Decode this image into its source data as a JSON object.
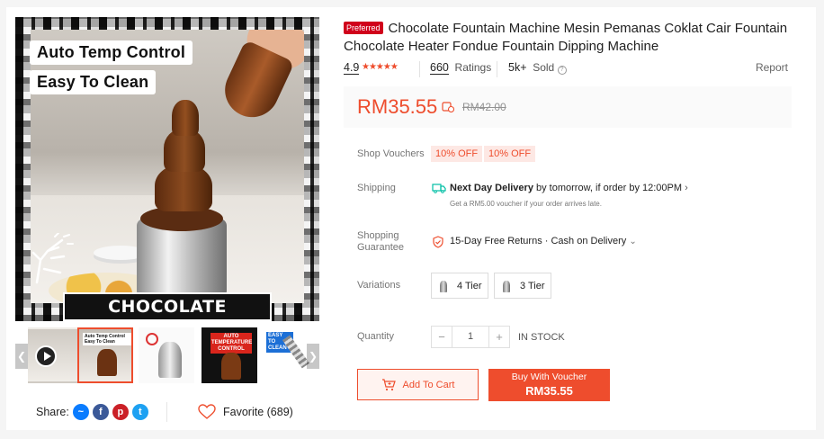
{
  "gallery": {
    "main_image": {
      "tag_top": "Auto Temp Control",
      "tag_bottom": "Easy To Clean",
      "banner": "CHOCOLATE FONDUE",
      "alt": "chocolate fountain photo"
    },
    "thumbnails": [
      {
        "kind": "video",
        "icon": "play-icon"
      },
      {
        "kind": "image",
        "caption": "Auto Temp Control Easy To Clean"
      },
      {
        "kind": "image",
        "caption": ""
      },
      {
        "kind": "image",
        "caption": "AUTO TEMPERATURE CONTROL"
      },
      {
        "kind": "image",
        "caption": "EASY TO CLEAN"
      }
    ]
  },
  "share": {
    "label": "Share:",
    "networks": [
      {
        "name": "messenger",
        "icon": "messenger-icon",
        "color": "#0a7cff",
        "glyph": "~"
      },
      {
        "name": "facebook",
        "icon": "facebook-icon",
        "color": "#3b5998",
        "glyph": "f"
      },
      {
        "name": "pinterest",
        "icon": "pinterest-icon",
        "color": "#cb2027",
        "glyph": "p"
      },
      {
        "name": "twitter",
        "icon": "twitter-icon",
        "color": "#1da1f2",
        "glyph": "t"
      }
    ]
  },
  "favorite": {
    "label": "Favorite (689)"
  },
  "product": {
    "badge": "Preferred",
    "title": "Chocolate Fountain Machine Mesin Pemanas Coklat Cair Fountain Chocolate Heater Fondue Fountain Dipping Machine",
    "rating": "4.9",
    "stars": "★★★★★",
    "ratings_count": "660",
    "ratings_label": "Ratings",
    "sold_count": "5k+",
    "sold_label": "Sold",
    "report": "Report",
    "price": "RM35.55",
    "original_price": "RM42.00"
  },
  "labels": {
    "vouchers": "Shop Vouchers",
    "shipping": "Shipping",
    "guarantee_1": "Shopping",
    "guarantee_2": "Guarantee",
    "variations": "Variations",
    "quantity": "Quantity"
  },
  "vouchers": [
    "10% OFF",
    "10% OFF"
  ],
  "shipping": {
    "bold": "Next Day Delivery",
    "rest": " by tomorrow, if order by 12:00PM",
    "sub": "Get a RM5.00 voucher if your order arrives late."
  },
  "guarantee": {
    "text": "15-Day Free Returns · Cash on Delivery"
  },
  "variations": [
    "4 Tier",
    "3 Tier"
  ],
  "quantity": {
    "minus": "−",
    "value": "1",
    "plus": "+",
    "stock": "IN STOCK"
  },
  "actions": {
    "add_to_cart": "Add To Cart",
    "buy_line1": "Buy With Voucher",
    "buy_line2": "RM35.55"
  },
  "colors": {
    "accent": "#ee4d2d",
    "badge": "#d0011b"
  }
}
